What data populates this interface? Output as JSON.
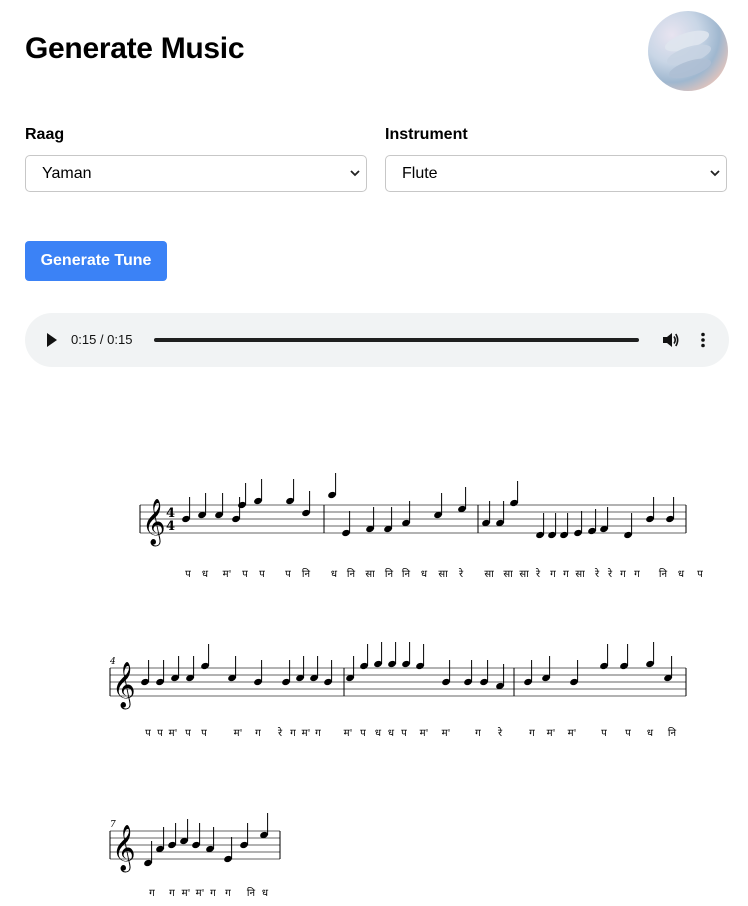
{
  "page": {
    "title": "Generate Music"
  },
  "form": {
    "raag": {
      "label": "Raag",
      "value": "Yaman"
    },
    "instrument": {
      "label": "Instrument",
      "value": "Flute"
    },
    "generate_label": "Generate Tune"
  },
  "player": {
    "time": "0:15 / 0:15",
    "progress": 1.0
  },
  "score": {
    "time_signature": "4/4",
    "system_numbers": [
      "4",
      "7"
    ],
    "lyrics": [
      [
        "प",
        "ध",
        "म'",
        "प",
        "प",
        "प",
        "नि",
        "ध",
        "नि",
        "सा",
        "नि",
        "नि",
        "ध",
        "सा",
        "रे",
        "सा",
        "सा",
        "सा",
        "रे",
        "ग",
        "ग",
        "सा",
        "रे",
        "रे",
        "ग",
        "ग",
        "नि",
        "ध",
        "प"
      ],
      [
        "प",
        "प",
        "म'",
        "प",
        "प",
        "म'",
        "ग",
        "रे",
        "ग",
        "म'",
        "ग",
        "म'",
        "प",
        "ध",
        "ध",
        "प",
        "म'",
        "म'",
        "ग",
        "रे",
        "ग",
        "म'",
        "म'",
        "प",
        "प",
        "ध",
        "नि"
      ],
      [
        "ग",
        "ग",
        "म'",
        "म'",
        "ग",
        "ग",
        "नि",
        "ध"
      ]
    ]
  }
}
